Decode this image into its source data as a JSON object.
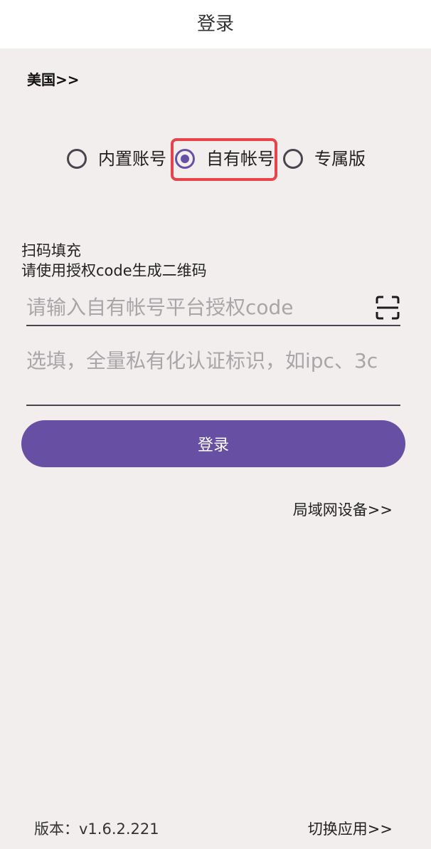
{
  "header": {
    "title": "登录"
  },
  "region": {
    "label": "美国>>"
  },
  "account_types": {
    "options": [
      {
        "label": "内置账号",
        "selected": false
      },
      {
        "label": "自有帐号",
        "selected": true
      },
      {
        "label": "专属版",
        "selected": false
      }
    ],
    "highlight_color": "#e8424b"
  },
  "scan": {
    "title": "扫码填充",
    "hint": "请使用授权code生成二维码",
    "icon": "qr-scan-icon"
  },
  "form": {
    "code_placeholder": "请输入自有帐号平台授权code",
    "code_value": "",
    "private_placeholder": "选填，全量私有化认证标识，如ipc、3c",
    "private_value": ""
  },
  "actions": {
    "login_label": "登录",
    "lan_devices_label": "局域网设备>>"
  },
  "footer": {
    "version_label": "版本：v1.6.2.221",
    "switch_app_label": "切换应用>>"
  },
  "colors": {
    "primary": "#6750a4",
    "background": "#f3eeee",
    "topbar": "#ffffff"
  }
}
